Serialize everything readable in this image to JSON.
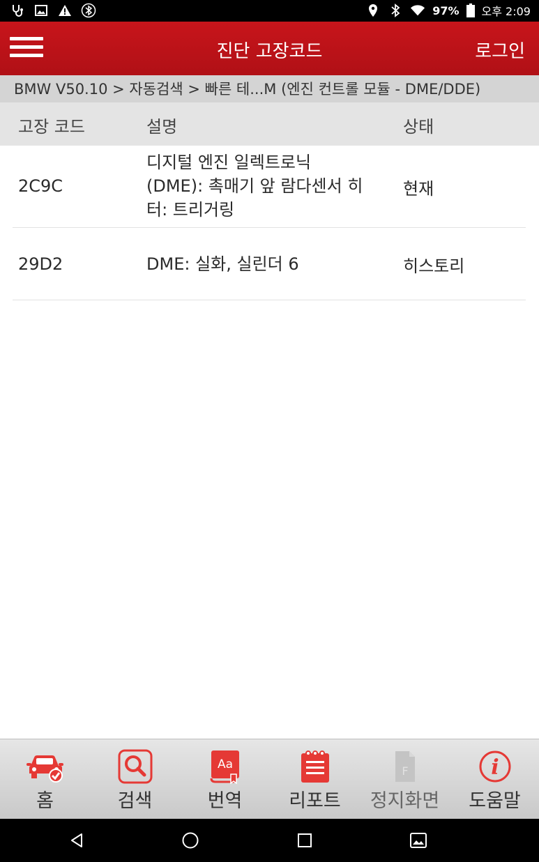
{
  "status_bar": {
    "battery": "97%",
    "time": "오후 2:09"
  },
  "app_bar": {
    "title": "진단 고장코드",
    "login_label": "로그인"
  },
  "breadcrumb": "BMW V50.10 > 자동검색 > 빠른 테...M (엔진 컨트롤 모듈 - DME/DDE)",
  "table": {
    "headers": [
      "고장 코드",
      "설명",
      "상태"
    ],
    "rows": [
      {
        "code": "2C9C",
        "description_lines": [
          "디지털 엔진 일렉트로닉",
          "(DME): 촉매기 앞 람다센서 히",
          "터: 트리거링"
        ],
        "status": "현재"
      },
      {
        "code": "29D2",
        "description_lines": [
          "DME: 실화, 실린더 6"
        ],
        "status": "히스토리"
      }
    ]
  },
  "bottom_nav": {
    "items": [
      {
        "label": "홈",
        "icon": "car-check-icon"
      },
      {
        "label": "검색",
        "icon": "search-icon"
      },
      {
        "label": "번역",
        "icon": "translate-book-icon"
      },
      {
        "label": "리포트",
        "icon": "report-notepad-icon"
      },
      {
        "label": "정지화면",
        "icon": "document-icon"
      },
      {
        "label": "도움말",
        "icon": "info-icon"
      }
    ]
  },
  "colors": {
    "primary_red": "#c8151b",
    "nav_icon_red": "#e53935"
  }
}
